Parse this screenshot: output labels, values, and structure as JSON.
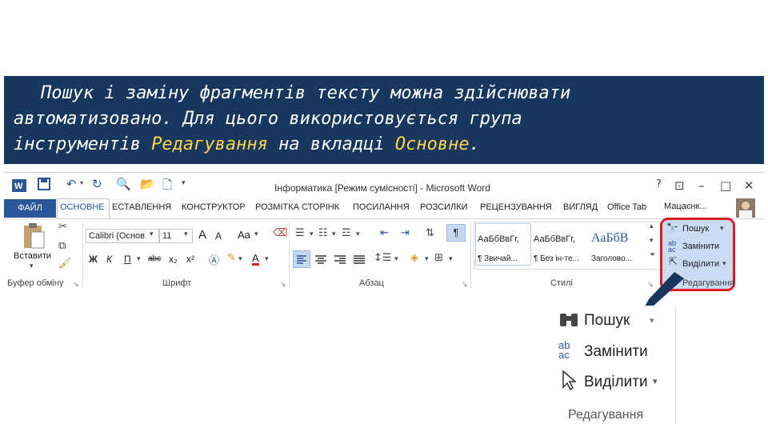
{
  "banner": {
    "line1": "Пошук і заміну фрагментів тексту можна здійснювати",
    "line2": "автоматизовано. Для цього використовується група",
    "line3_prefix": "інструментів ",
    "group_name": "Редагування",
    "line3_mid": " на вкладці ",
    "tab_name": "Основне",
    "line3_end": "."
  },
  "window": {
    "title": "Інформатика [Режим сумісності] - Microsoft Word",
    "help": "?",
    "user": "Мацаєнк..."
  },
  "tabs": {
    "file": "ФАЙЛ",
    "items": [
      "ОСНОВНЕ",
      "ЕСТАВЛЕННЯ",
      "КОНСТРУКТОР",
      "РОЗМІТКА СТОРІНК",
      "ПОСИЛАННЯ",
      "РОЗСИЛКИ",
      "РЕЦЕНЗУВАННЯ",
      "ВИГЛЯД",
      "Office Tab"
    ]
  },
  "clipboard": {
    "paste": "Вставити",
    "label": "Буфер обміну"
  },
  "font": {
    "font_name": "Calibri (Основ",
    "font_size": "11",
    "grow": "A",
    "shrink": "A",
    "case": "Aa",
    "bold": "Ж",
    "italic": "К",
    "underline": "П",
    "strike": "abc",
    "sub": "x₂",
    "sup": "x²",
    "label": "Шрифт"
  },
  "paragraph": {
    "label": "Абзац"
  },
  "styles": {
    "items": [
      {
        "sample": "АаБбВвГг,",
        "name": "¶ Звичай..."
      },
      {
        "sample": "АаБбВвГг,",
        "name": "¶ Без ін-те..."
      },
      {
        "sample": "АаБбВ",
        "name": "Заголово..."
      }
    ],
    "label": "Стилі"
  },
  "editing": {
    "find": "Пошук",
    "replace": "Замінити",
    "select": "Виділити",
    "label": "Редагування"
  },
  "zoom": {
    "find": "Пошук",
    "replace": "Замінити",
    "select": "Виділити",
    "label": "Редагування"
  },
  "colors": {
    "banner_bg": "#17375e",
    "highlight_text": "#ffd24a",
    "word_blue": "#2b579a",
    "callout_red": "#e21b23"
  }
}
